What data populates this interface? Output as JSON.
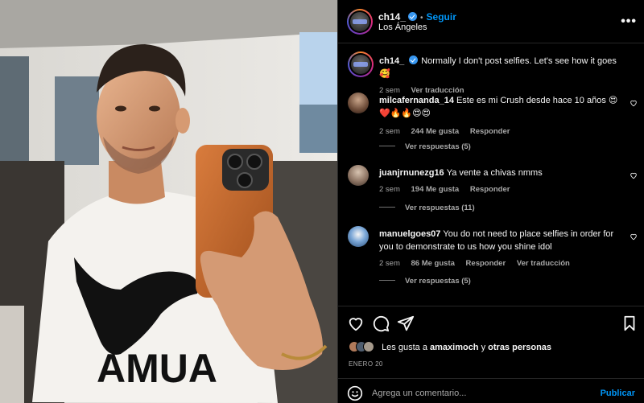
{
  "post": {
    "username": "ch14_",
    "location": "Los Ángeles",
    "follow_label": "Seguir",
    "separator": "•",
    "more_label": "•••"
  },
  "caption": {
    "username": "ch14_",
    "text": "Normally I don't post selfies. Let's see how it goes 🥰",
    "time": "2 sem",
    "translate": "Ver traducción"
  },
  "comments": [
    {
      "username": "milcafernanda_14",
      "text": "Este es mi Crush desde hace 10 años 😍❤️🔥🔥😍😍",
      "time": "2 sem",
      "likes": "244 Me gusta",
      "reply": "Responder",
      "view_replies": "Ver respuestas (5)"
    },
    {
      "username": "juanjrnunezg16",
      "text": "Ya vente a chivas nmms",
      "time": "2 sem",
      "likes": "194 Me gusta",
      "reply": "Responder",
      "view_replies": "Ver respuestas (11)"
    },
    {
      "username": "manuelgoes07",
      "text": "You do not need to place selfies in order for you to demonstrate to us how you shine idol",
      "time": "2 sem",
      "likes": "86 Me gusta",
      "reply": "Responder",
      "translate": "Ver traducción",
      "view_replies": "Ver respuestas (5)"
    }
  ],
  "likes": {
    "prefix": "Les gusta a ",
    "user": "amaximoch",
    "connector": " y ",
    "others": "otras personas"
  },
  "date": "ENERO 20",
  "add_comment": {
    "placeholder": "Agrega un comentario...",
    "post_label": "Publicar"
  },
  "icons": [
    "heart-icon",
    "comment-icon",
    "share-icon",
    "bookmark-icon",
    "emoji-icon",
    "more-icon",
    "verified-icon"
  ],
  "colors": {
    "accent": "#0095f6",
    "background": "#000000",
    "muted": "#a8a8a8",
    "verified": "#3897f0"
  }
}
